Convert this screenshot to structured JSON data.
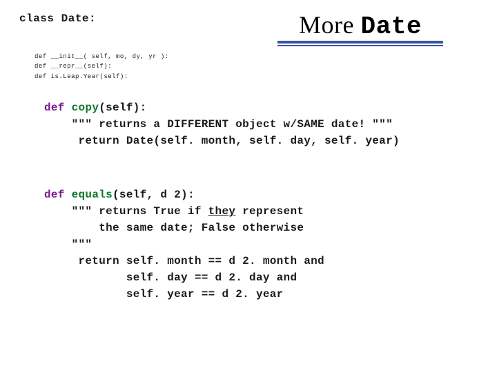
{
  "header": {
    "classLine": "class Date:",
    "title_plain": "More ",
    "title_mono": "Date"
  },
  "smallDefs": {
    "l1": "def __init__( self, mo, dy, yr ):",
    "l2": "def __repr__(self):",
    "l3": "def is.Leap.Year(self):"
  },
  "copy": {
    "sig_def": "def",
    "sig_name": " copy",
    "sig_rest": "(self):",
    "doc": "    \"\"\" returns a DIFFERENT object w/SAME date! \"\"\"",
    "ret": "     return Date(self. month, self. day, self. year)"
  },
  "equals": {
    "sig_def": "def",
    "sig_name": " equals",
    "sig_rest": "(self, d 2):",
    "d1a": "    \"\"\" returns True if ",
    "d1b": "they",
    "d1c": " represent",
    "d2": "        the same date; False otherwise",
    "d3": "    \"\"\"",
    "r1": "     return self. month == d 2. month and",
    "r2": "            self. day == d 2. day and",
    "r3": "            self. year == d 2. year"
  }
}
